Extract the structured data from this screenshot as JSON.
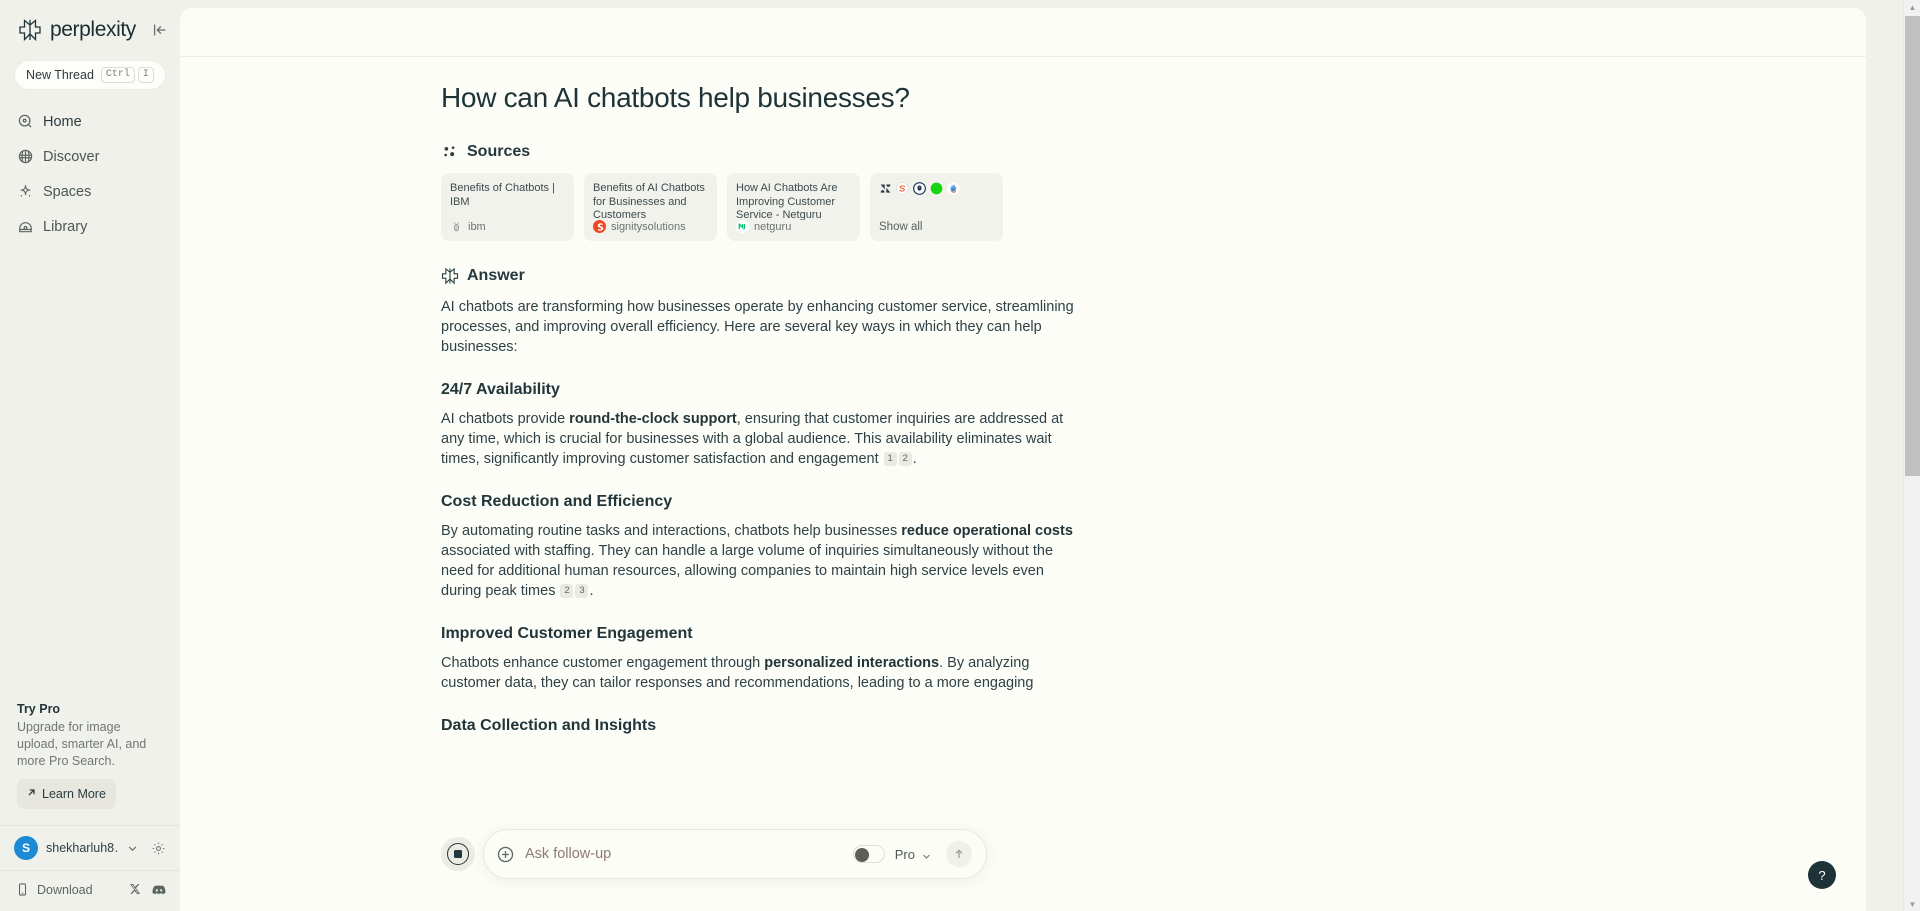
{
  "sidebar": {
    "brand": "perplexity",
    "collapse_icon": "panel-collapse-icon",
    "new_thread": {
      "label": "New Thread",
      "keys": [
        "Ctrl",
        "I"
      ]
    },
    "nav": [
      {
        "label": "Home",
        "icon": "home-search-icon",
        "active": true
      },
      {
        "label": "Discover",
        "icon": "globe-icon",
        "active": false
      },
      {
        "label": "Spaces",
        "icon": "sparkle-icon",
        "active": false
      },
      {
        "label": "Library",
        "icon": "library-icon",
        "active": false
      }
    ],
    "try_pro": {
      "title": "Try Pro",
      "description": "Upgrade for image upload, smarter AI, and more Pro Search.",
      "cta": "Learn More",
      "cta_icon": "arrow-up-right-icon"
    },
    "user": {
      "initial": "S",
      "name": "shekharluh8…",
      "avatar_color": "#1e8ad6",
      "chevron_icon": "chevron-down-icon",
      "settings_icon": "gear-icon"
    },
    "footer": {
      "download_label": "Download",
      "download_icon": "mobile-icon",
      "social": [
        "x-icon",
        "discord-icon"
      ]
    }
  },
  "main": {
    "question": "How can AI chatbots help businesses?",
    "sources": {
      "heading": "Sources",
      "heading_icon": "sources-dots-icon",
      "cards": [
        {
          "title": "Benefits of Chatbots | IBM",
          "domain": "ibm",
          "favicon": "ibm-icon"
        },
        {
          "title": "Benefits of AI Chatbots for Businesses and Customers",
          "domain": "signitysolutions",
          "favicon": "signity-icon"
        },
        {
          "title": "How AI Chatbots Are Improving Customer Service - Netguru",
          "domain": "netguru",
          "favicon": "netguru-icon"
        }
      ],
      "show_all": {
        "label": "Show all",
        "icons": [
          "zendesk-icon",
          "sendbird-icon",
          "target-icon",
          "green-circle-icon",
          "hand-icon"
        ]
      }
    },
    "answer": {
      "heading": "Answer",
      "heading_icon": "perplexity-mark-icon",
      "intro": "AI chatbots are transforming how businesses operate by enhancing customer service, streamlining processes, and improving overall efficiency. Here are several key ways in which they can help businesses:",
      "sections": [
        {
          "heading": "24/7 Availability",
          "text_before": "AI chatbots provide ",
          "bold": "round-the-clock support",
          "text_after": ", ensuring that customer inquiries are addressed at any time, which is crucial for businesses with a global audience. This availability eliminates wait times, significantly improving customer satisfaction and engagement ",
          "citations": [
            "1",
            "2"
          ],
          "tail": "."
        },
        {
          "heading": "Cost Reduction and Efficiency",
          "text_before": "By automating routine tasks and interactions, chatbots help businesses ",
          "bold": "reduce operational costs",
          "text_after": " associated with staffing. They can handle a large volume of inquiries simultaneously without the need for additional human resources, allowing companies to maintain high service levels even during peak times ",
          "citations": [
            "2",
            "3"
          ],
          "tail": "."
        },
        {
          "heading": "Improved Customer Engagement",
          "text_before": "Chatbots enhance customer engagement through ",
          "bold": "personalized interactions",
          "text_after": ". By analyzing customer data, they can tailor responses and recommendations, leading to a more engaging",
          "citations": [],
          "tail": ""
        }
      ],
      "next_heading": "Data Collection and Insights"
    }
  },
  "composer": {
    "stop_icon": "stop-recording-icon",
    "attach_icon": "plus-circle-icon",
    "placeholder": "Ask follow-up",
    "value": "",
    "pro_label": "Pro",
    "pro_enabled": false,
    "pro_chevron_icon": "chevron-down-icon",
    "send_icon": "arrow-up-icon"
  },
  "help": {
    "label": "?",
    "icon": "question-mark-icon"
  },
  "scrollbar": {
    "up_icon": "caret-up-icon",
    "down_icon": "caret-down-icon"
  },
  "colors": {
    "accent": "#1e8ad6",
    "bg": "#f1f1ec",
    "panel": "#fcfdf7",
    "text": "#2f4146"
  }
}
